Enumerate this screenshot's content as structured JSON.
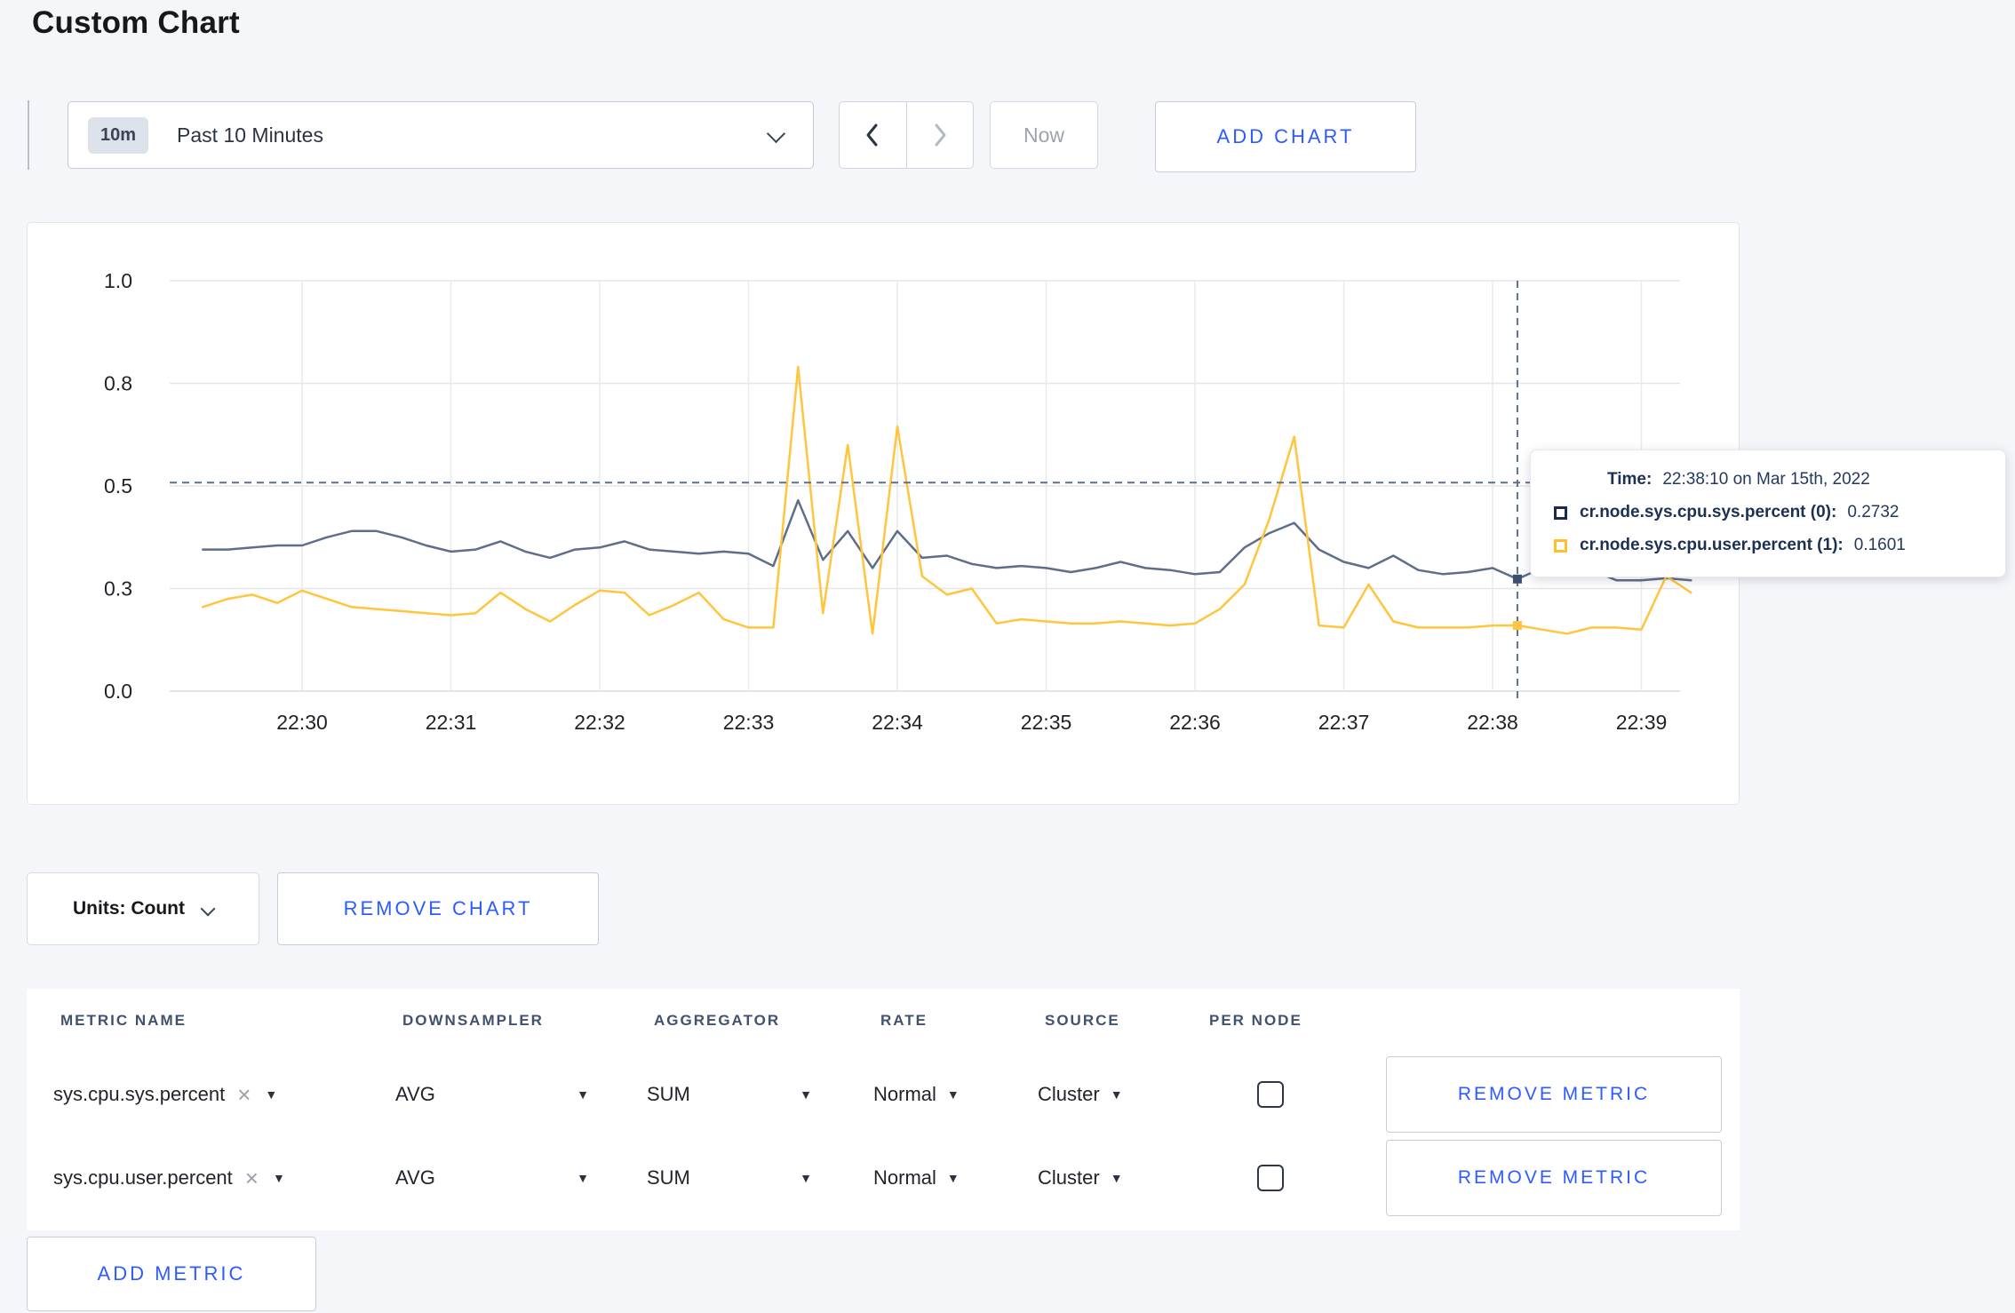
{
  "page": {
    "title": "Custom Chart",
    "accent_blue": "#2d5bff",
    "background": "#f5f6fa"
  },
  "toolbar": {
    "time_scale": {
      "badge": "10m",
      "label": "Past 10 Minutes"
    },
    "now_label": "Now",
    "add_chart_label": "ADD CHART"
  },
  "tooltip": {
    "time_label": "Time:",
    "time_value": "22:38:10 on Mar 15th, 2022",
    "series": [
      {
        "label": "cr.node.sys.cpu.sys.percent (0):",
        "value": "0.2732",
        "swatch_color": "#1c2b4d"
      },
      {
        "label": "cr.node.sys.cpu.user.percent (1):",
        "value": "0.1601",
        "swatch_color": "#ffc02b"
      }
    ]
  },
  "chart_data": {
    "type": "line",
    "title": "",
    "xlabel": "",
    "ylabel": "",
    "grid": true,
    "legend": "hover tooltip only",
    "ylim": [
      0,
      1
    ],
    "y_axis": {
      "max": 1,
      "ticks": [
        {
          "value": 0,
          "label": "0.0"
        },
        {
          "value": 0.25,
          "label": "0.3"
        },
        {
          "value": 0.5,
          "label": "0.5"
        },
        {
          "value": 0.75,
          "label": "0.8"
        },
        {
          "value": 1,
          "label": "1.0"
        }
      ]
    },
    "x_axis": {
      "tick_labels": [
        "22:30",
        "22:31",
        "22:32",
        "22:33",
        "22:34",
        "22:35",
        "22:36",
        "22:37",
        "22:38",
        "22:39"
      ],
      "tick_interval_seconds": 60
    },
    "series": [
      {
        "name": "cr.node.sys.cpu.sys.percent (0)",
        "color": "#5f6e88",
        "start_offset_seconds": -40,
        "step_seconds": 10,
        "values": [
          0.345,
          0.345,
          0.35,
          0.355,
          0.355,
          0.375,
          0.39,
          0.39,
          0.375,
          0.355,
          0.34,
          0.345,
          0.365,
          0.34,
          0.325,
          0.345,
          0.35,
          0.365,
          0.345,
          0.34,
          0.335,
          0.34,
          0.335,
          0.305,
          0.465,
          0.32,
          0.39,
          0.3,
          0.39,
          0.325,
          0.33,
          0.31,
          0.3,
          0.305,
          0.3,
          0.29,
          0.3,
          0.315,
          0.3,
          0.295,
          0.285,
          0.29,
          0.35,
          0.385,
          0.41,
          0.345,
          0.315,
          0.3,
          0.33,
          0.295,
          0.285,
          0.29,
          0.3,
          0.2732,
          0.3,
          0.31,
          0.295,
          0.27,
          0.27,
          0.275,
          0.27
        ]
      },
      {
        "name": "cr.node.sys.cpu.user.percent (1)",
        "color": "#ffc53d",
        "start_offset_seconds": -40,
        "step_seconds": 10,
        "values": [
          0.205,
          0.225,
          0.235,
          0.215,
          0.245,
          0.225,
          0.205,
          0.2,
          0.195,
          0.19,
          0.185,
          0.19,
          0.24,
          0.2,
          0.17,
          0.21,
          0.245,
          0.24,
          0.185,
          0.21,
          0.24,
          0.175,
          0.155,
          0.155,
          0.79,
          0.19,
          0.6,
          0.14,
          0.645,
          0.28,
          0.235,
          0.25,
          0.165,
          0.175,
          0.17,
          0.165,
          0.165,
          0.17,
          0.165,
          0.16,
          0.165,
          0.2,
          0.26,
          0.42,
          0.62,
          0.16,
          0.155,
          0.26,
          0.17,
          0.155,
          0.155,
          0.155,
          0.16,
          0.1601,
          0.15,
          0.14,
          0.155,
          0.155,
          0.15,
          0.28,
          0.24
        ]
      }
    ],
    "crosshair": {
      "time_label": "22:38:10",
      "x_offset_seconds": 490,
      "horizontal_value": 0.508,
      "points": [
        {
          "series": 0,
          "value": 0.2732,
          "dot_color": "#3e4f6d"
        },
        {
          "series": 1,
          "value": 0.1601,
          "dot_color": "#ffc53d"
        }
      ]
    }
  },
  "chart_controls": {
    "units_label": "Units: Count",
    "remove_chart_label": "REMOVE CHART"
  },
  "metrics_table": {
    "headers": [
      "METRIC NAME",
      "DOWNSAMPLER",
      "AGGREGATOR",
      "RATE",
      "SOURCE",
      "PER NODE"
    ],
    "rows": [
      {
        "metric_name": "sys.cpu.sys.percent",
        "downsampler": "AVG",
        "aggregator": "SUM",
        "rate": "Normal",
        "source": "Cluster",
        "per_node_checked": false,
        "remove_label": "REMOVE METRIC"
      },
      {
        "metric_name": "sys.cpu.user.percent",
        "downsampler": "AVG",
        "aggregator": "SUM",
        "rate": "Normal",
        "source": "Cluster",
        "per_node_checked": false,
        "remove_label": "REMOVE METRIC"
      }
    ],
    "add_metric_label": "ADD METRIC"
  }
}
